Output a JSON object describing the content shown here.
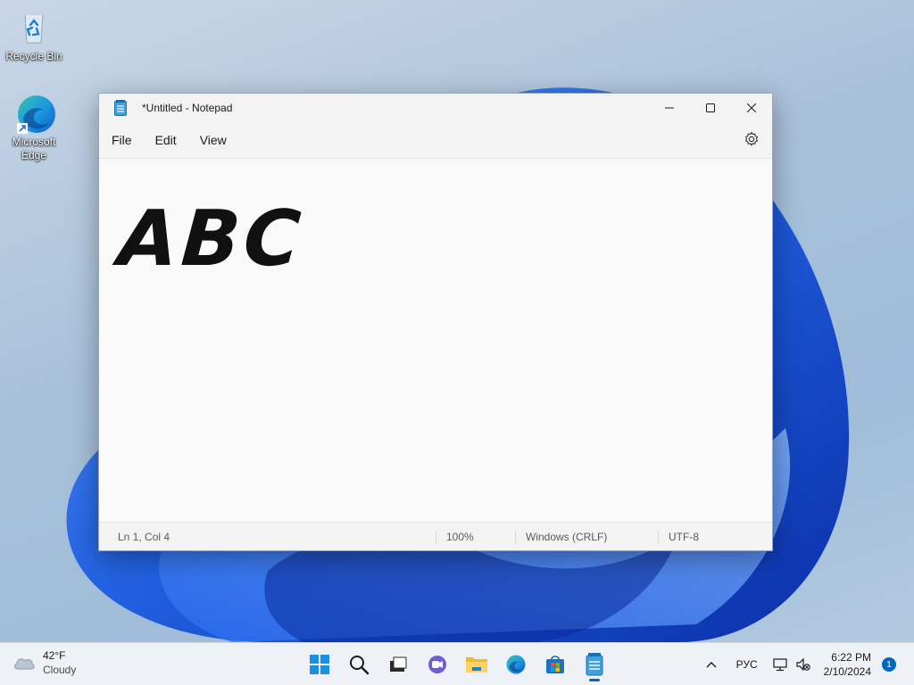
{
  "desktop": {
    "icons": [
      {
        "label": "Recycle Bin",
        "icon": "recycle-bin-icon"
      },
      {
        "label": "Microsoft Edge",
        "icon": "edge-icon"
      }
    ]
  },
  "notepad": {
    "title": "*Untitled - Notepad",
    "menu": {
      "file": "File",
      "edit": "Edit",
      "view": "View"
    },
    "content": "ABC",
    "status": {
      "position": "Ln 1, Col 4",
      "zoom": "100%",
      "line_ending": "Windows (CRLF)",
      "encoding": "UTF-8"
    }
  },
  "taskbar": {
    "weather": {
      "temp": "42°F",
      "condition": "Cloudy"
    },
    "apps": [
      "start-icon",
      "search-icon",
      "task-view-icon",
      "chat-icon",
      "file-explorer-icon",
      "edge-icon",
      "store-icon",
      "notepad-icon"
    ],
    "tray": {
      "language": "РУС",
      "time": "6:22 PM",
      "date": "2/10/2024",
      "notifications": "1"
    }
  },
  "colors": {
    "accent": "#0067c0",
    "wallpaper_blue": "#1f5fe0"
  }
}
